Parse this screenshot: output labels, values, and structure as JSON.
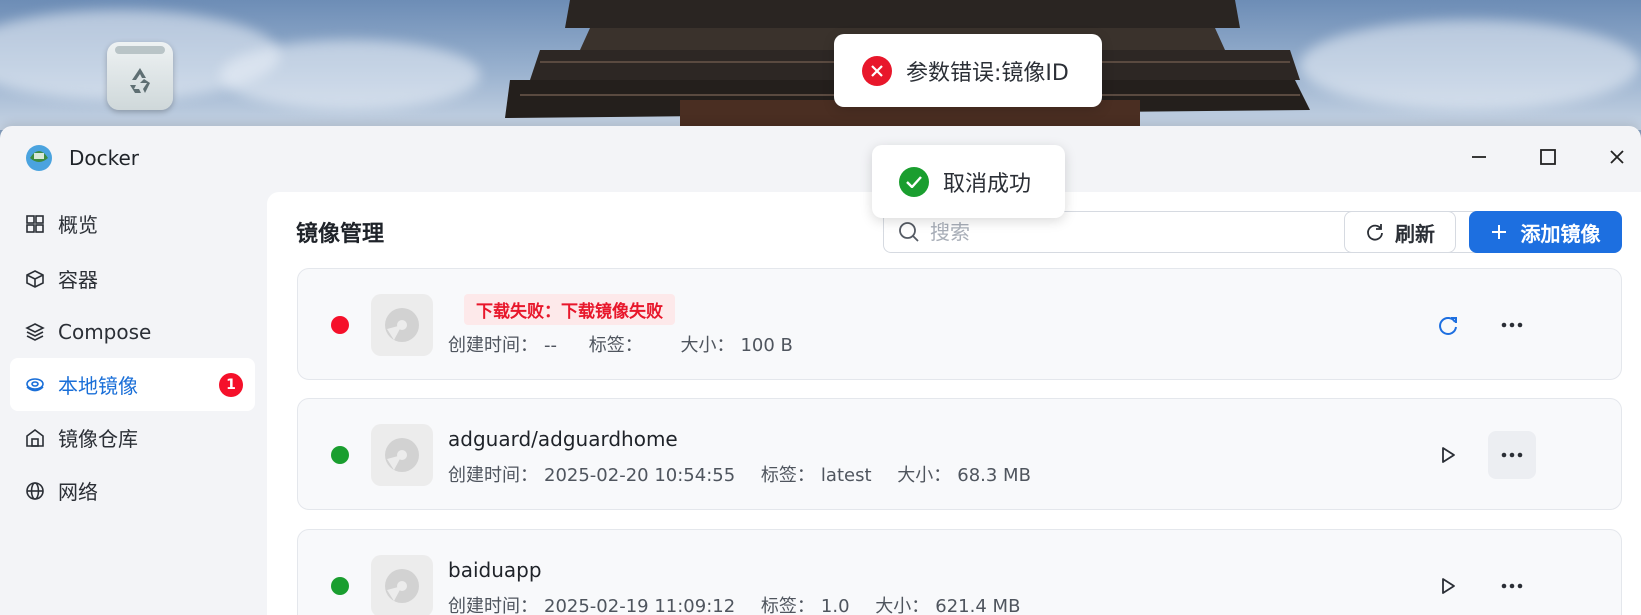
{
  "window": {
    "title": "Docker"
  },
  "sidebar": {
    "items": [
      {
        "label": "概览",
        "icon": "grid-icon"
      },
      {
        "label": "容器",
        "icon": "cube-icon"
      },
      {
        "label": "Compose",
        "icon": "layers-icon"
      },
      {
        "label": "本地镜像",
        "icon": "disc-icon",
        "active": true,
        "badge": "1"
      },
      {
        "label": "镜像仓库",
        "icon": "warehouse-icon"
      },
      {
        "label": "网络",
        "icon": "globe-icon"
      }
    ]
  },
  "main": {
    "title": "镜像管理",
    "search": {
      "placeholder": "搜索",
      "value": ""
    },
    "refresh_label": "刷新",
    "add_label": "添加镜像",
    "images": [
      {
        "status": "error",
        "error_text": "下载失败：下载镜像失败",
        "created_label": "创建时间：",
        "created": "--",
        "tag_label": "标签：",
        "tag": "",
        "size_label": "大小：",
        "size": "100 B",
        "primary_action": "retry-icon"
      },
      {
        "status": "ok",
        "name": "adguard/adguardhome",
        "created_label": "创建时间：",
        "created": "2025-02-20 10:54:55",
        "tag_label": "标签：",
        "tag": "latest",
        "size_label": "大小：",
        "size": "68.3 MB",
        "primary_action": "play-icon"
      },
      {
        "status": "ok",
        "name": "baiduapp",
        "created_label": "创建时间：",
        "created": "2025-02-19 11:09:12",
        "tag_label": "标签：",
        "tag": "1.0",
        "size_label": "大小：",
        "size": "621.4 MB",
        "primary_action": "play-icon"
      }
    ]
  },
  "toasts": {
    "error": "参数错误:镜像ID",
    "success": "取消成功"
  },
  "colors": {
    "accent": "#1d6fe0",
    "error": "#e8172b",
    "success": "#1a9e2f",
    "badge": "#f5102a"
  }
}
